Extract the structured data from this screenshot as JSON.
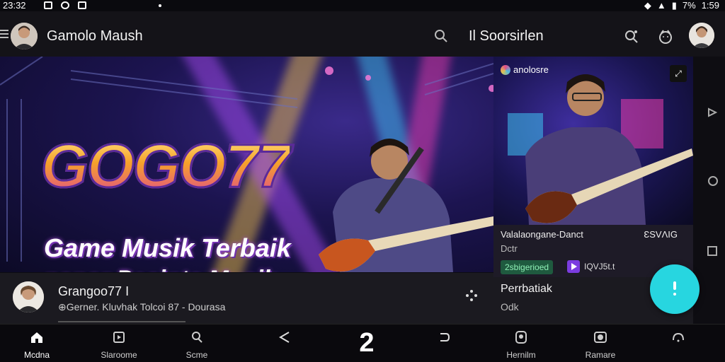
{
  "status_bar": {
    "time": "23:32",
    "battery": "7%",
    "clock_right": "1:59"
  },
  "app_bar": {
    "title": "Gamolo Maush",
    "subtitle": "Il Soorsirlen",
    "icons": [
      "menu-icon",
      "search-icon",
      "search-plus-icon",
      "face-icon"
    ]
  },
  "hero": {
    "logo": "GOGO77",
    "tagline_1": "Game Musik Terbaik",
    "tagline_2": "papar Pecinta Musik"
  },
  "side_card": {
    "badge": "anolosre",
    "expand_label": "⤢",
    "info_title": "Valalaongane-Danct",
    "info_count": "ƐSVΛIG",
    "info_sub": "Dctr",
    "chip_green": "2sbigerioed",
    "chip_text": "IQVJ5t.t"
  },
  "now_playing": {
    "title": "Grangoo77 I",
    "subtitle": "⊕Gerner. Kluvhak Tolcoi 87 - Dourasa"
  },
  "recommend": {
    "title": "Perrbatiak",
    "subtitle": "Odk"
  },
  "bottom_nav": {
    "items": [
      {
        "label": "Mcdna",
        "icon": "home-icon"
      },
      {
        "label": "Slaroome",
        "icon": "library-icon"
      },
      {
        "label": "Scme",
        "icon": "search-icon"
      },
      {
        "label": "",
        "icon": "back-triangle-icon"
      },
      {
        "label": "",
        "icon": "return-icon"
      },
      {
        "label": "Hernilm",
        "icon": "profile-icon"
      },
      {
        "label": "Ramare",
        "icon": "camera-icon"
      },
      {
        "label": "",
        "icon": "refresh-icon"
      }
    ],
    "center_label": "2"
  },
  "colors": {
    "fab": "#27d6e0",
    "accent_purple": "#7b3ce0",
    "chip_green": "#1f5a3f"
  }
}
